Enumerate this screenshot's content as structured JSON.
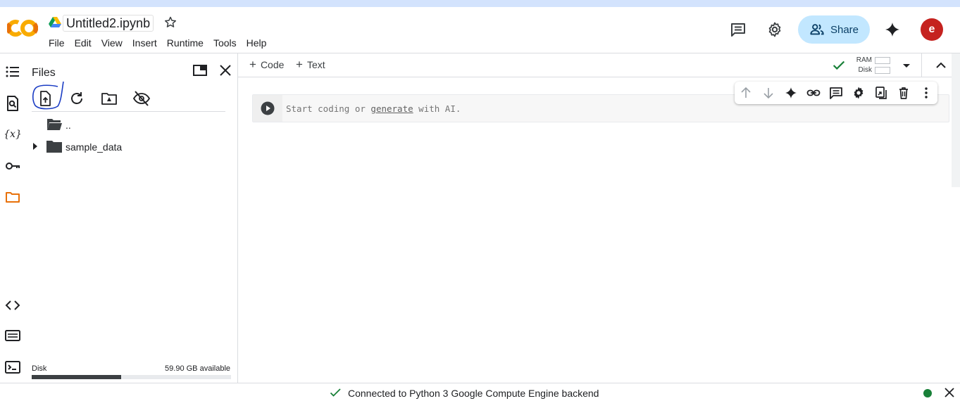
{
  "header": {
    "notebook_title": "Untitled2.ipynb",
    "menu": [
      "File",
      "Edit",
      "View",
      "Insert",
      "Runtime",
      "Tools",
      "Help"
    ],
    "share_label": "Share",
    "avatar_letter": "e"
  },
  "rail": {
    "icons": [
      "table-of-contents-icon",
      "find-icon",
      "variables-icon",
      "secrets-key-icon",
      "files-folder-icon",
      "code-snippets-icon",
      "command-palette-icon",
      "terminal-icon"
    ]
  },
  "files_panel": {
    "title": "Files",
    "tree": [
      {
        "name": "..",
        "expandable": false
      },
      {
        "name": "sample_data",
        "expandable": true
      }
    ],
    "disk_label": "Disk",
    "disk_available": "59.90 GB available",
    "disk_used_fraction": 0.45
  },
  "toolbar": {
    "add_code": "Code",
    "add_text": "Text",
    "ram_label": "RAM",
    "disk_label": "Disk"
  },
  "cell": {
    "placeholder_before": "Start coding or ",
    "placeholder_link": "generate",
    "placeholder_after": " with AI."
  },
  "status": {
    "text": "Connected to Python 3 Google Compute Engine backend"
  },
  "colors": {
    "accent_blue": "#c2e7ff",
    "avatar_red": "#c5221f",
    "connected_green": "#188038",
    "files_orange": "#e8710a"
  }
}
